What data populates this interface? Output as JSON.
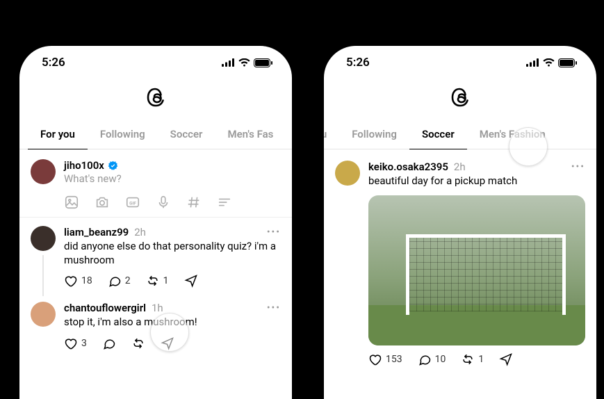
{
  "status": {
    "time": "5:26"
  },
  "tabs": {
    "for_you": "For you",
    "following": "Following",
    "soccer": "Soccer",
    "mens_fashion": "Men's Fashion"
  },
  "left": {
    "compose": {
      "username": "jiho100x",
      "prompt": "What's new?"
    },
    "post1": {
      "username": "liam_beanz99",
      "ago": "2h",
      "text": "did anyone else do that personality quiz? i'm a mushroom",
      "likes": "18",
      "replies": "2",
      "reposts": "1"
    },
    "post2": {
      "username": "chantouflowergirl",
      "ago": "1h",
      "text": "stop it, i'm also a mushroom!",
      "likes": "3"
    }
  },
  "right": {
    "tabs_visible_first": "you",
    "post": {
      "username": "keiko.osaka2395",
      "ago": "2h",
      "text": "beautiful day for a pickup match",
      "likes": "153",
      "replies": "10",
      "reposts": "1"
    }
  }
}
